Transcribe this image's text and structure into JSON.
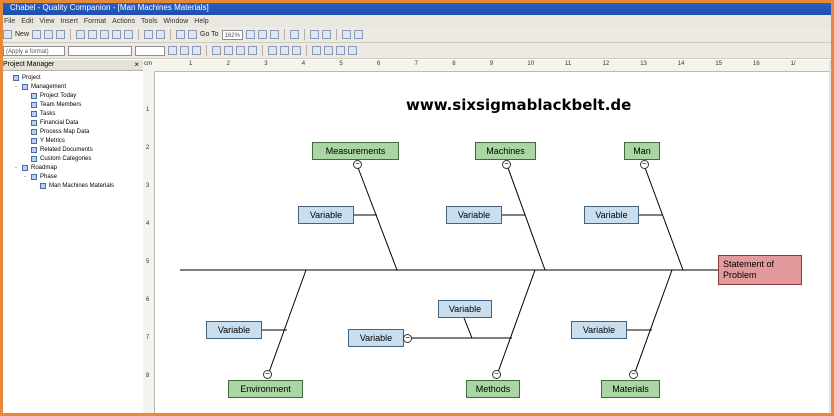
{
  "window": {
    "title": "Chabel - Quality Companion - [Man Machines Materials]"
  },
  "menu": [
    "File",
    "Edit",
    "View",
    "Insert",
    "Format",
    "Actions",
    "Tools",
    "Window",
    "Help"
  ],
  "toolbar1": {
    "new_label": "New",
    "zoom_label": "Go To",
    "zoom_value": "162%"
  },
  "toolbar2": {
    "format_placeholder": "(Apply a format)"
  },
  "project_manager": {
    "title": "Project Manager",
    "close_glyph": "×",
    "tree": [
      {
        "label": "Project",
        "level": 0,
        "toggle": ""
      },
      {
        "label": "Management",
        "level": 1,
        "toggle": "-"
      },
      {
        "label": "Project Today",
        "level": 2,
        "toggle": ""
      },
      {
        "label": "Team Members",
        "level": 2,
        "toggle": ""
      },
      {
        "label": "Tasks",
        "level": 2,
        "toggle": ""
      },
      {
        "label": "Financial Data",
        "level": 2,
        "toggle": ""
      },
      {
        "label": "Process Map Data",
        "level": 2,
        "toggle": ""
      },
      {
        "label": "Y Metrics",
        "level": 2,
        "toggle": ""
      },
      {
        "label": "Related Documents",
        "level": 2,
        "toggle": ""
      },
      {
        "label": "Custom Categories",
        "level": 2,
        "toggle": ""
      },
      {
        "label": "Roadmap",
        "level": 1,
        "toggle": "-"
      },
      {
        "label": "Phase",
        "level": 2,
        "toggle": "-"
      },
      {
        "label": "Man Machines Materials",
        "level": 3,
        "toggle": ""
      }
    ]
  },
  "ruler": {
    "top": [
      "cm",
      "1",
      "2",
      "3",
      "4",
      "5",
      "6",
      "7",
      "8",
      "9",
      "10",
      "11",
      "12",
      "13",
      "14",
      "15",
      "16",
      "1/"
    ],
    "left": [
      "1",
      "2",
      "3",
      "4",
      "5",
      "6",
      "7",
      "8"
    ]
  },
  "diagram": {
    "heading": "www.sixsigmablackbelt.de",
    "problem": "Statement of Problem",
    "categories": {
      "measurements": "Measurements",
      "machines": "Machines",
      "man": "Man",
      "environment": "Environment",
      "methods": "Methods",
      "materials": "Materials"
    },
    "variable_label": "Variable",
    "collapse_glyph": "−"
  },
  "colors": {
    "category": "#a9d6a2",
    "variable": "#c9dff0",
    "problem": "#e29a9d",
    "titlebar": "#1d4fb0",
    "frame": "#e8893a"
  }
}
